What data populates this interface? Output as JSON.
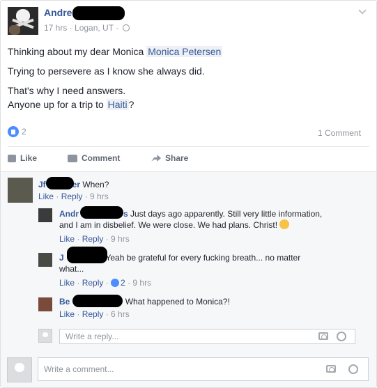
{
  "post": {
    "author": "Andre",
    "meta": "17 hrs · Logan, UT ·",
    "lines": {
      "l1_a": "Thinking about my dear Monica ",
      "l1_tag": "Monica Petersen",
      "l2": "Trying to persevere as I know she always did.",
      "l3": "That's why I need answers.",
      "l4_a": "Anyone up for a trip to ",
      "l4_tag": "Haiti",
      "l4_b": "?"
    },
    "like_count": "2",
    "comment_count": "1 Comment"
  },
  "actions": {
    "like": "Like",
    "comment": "Comment",
    "share": "Share"
  },
  "comments": [
    {
      "name_start": "Jf",
      "name_end": "er",
      "text": "When?",
      "like": "Like",
      "reply": "Reply",
      "time": "9 hrs"
    }
  ],
  "replies": [
    {
      "name_start": "Andr",
      "name_end": "s",
      "text_line1": "Just days ago apparently. Still very little information,",
      "text_line2": "and I am in disbelief. We were close. We had plans. Christ!",
      "like": "Like",
      "reply": "Reply",
      "time": "9 hrs"
    },
    {
      "name_start": "J",
      "name_end": "r",
      "text_line1": "Yeah be grateful for every fucking breath... no matter",
      "text_line2": "what...",
      "like": "Like",
      "reply": "Reply",
      "likes": "2",
      "time": "9 hrs"
    },
    {
      "name_start": "Be",
      "text_line1": "What happened to Monica?!",
      "like": "Like",
      "reply": "Reply",
      "time": "6 hrs"
    }
  ],
  "reply_box": {
    "placeholder": "Write a reply..."
  },
  "comment_box": {
    "placeholder": "Write a comment..."
  },
  "colors": {
    "link": "#365899",
    "muted": "#90949c",
    "like_blue": "#4c8eff",
    "comment_bg": "#f6f7f9"
  }
}
